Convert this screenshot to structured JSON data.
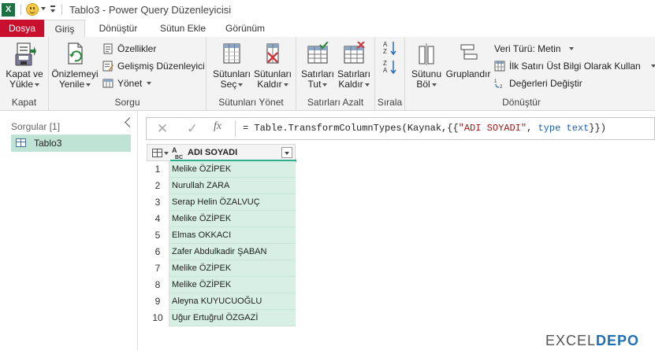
{
  "titlebar": {
    "app_icon": "X",
    "title": "Tablo3 - Power Query Düzenleyicisi"
  },
  "tabs": [
    {
      "label": "Dosya"
    },
    {
      "label": "Giriş"
    },
    {
      "label": "Dönüştür"
    },
    {
      "label": "Sütun Ekle"
    },
    {
      "label": "Görünüm"
    }
  ],
  "ribbon": {
    "kapat": {
      "btn1": "Kapat ve",
      "btn2": "Yükle",
      "group": "Kapat"
    },
    "sorgu": {
      "preview1": "Önizlemeyi",
      "preview2": "Yenile",
      "properties": "Özellikler",
      "advanced": "Gelişmiş Düzenleyici",
      "manage": "Yönet",
      "group": "Sorgu"
    },
    "columns": {
      "choose1": "Sütunları",
      "choose2": "Seç",
      "remove1": "Sütunları",
      "remove2": "Kaldır",
      "group": "Sütunları Yönet"
    },
    "rows": {
      "keep1": "Satırları",
      "keep2": "Tut",
      "remove1": "Satırları",
      "remove2": "Kaldır",
      "group": "Satırları Azalt"
    },
    "sort": {
      "group": "Sırala"
    },
    "transform": {
      "split1": "Sütunu",
      "split2": "Böl",
      "groupby": "Gruplandır",
      "datatype": "Veri Türü: Metin",
      "header": "İlk Satırı Üst Bilgi Olarak Kullan",
      "replace": "Değerleri Değiştir",
      "group": "Dönüştür"
    }
  },
  "queries": {
    "header": "Sorgular [1]",
    "items": [
      {
        "label": "Tablo3"
      }
    ]
  },
  "formula": {
    "fx": "fx",
    "part1": "= Table.TransformColumnTypes(Kaynak,{{",
    "part2": "\"ADI SOYADI\"",
    "part3": ", ",
    "part4": "type text",
    "part5": "}})"
  },
  "table": {
    "column": "ADI SOYADI",
    "type_icon_top": "A",
    "type_icon_bottom": "BC",
    "rows": [
      {
        "n": "1",
        "v": "Melike ÖZİPEK"
      },
      {
        "n": "2",
        "v": "Nurullah ZARA"
      },
      {
        "n": "3",
        "v": "Serap Helin ÖZALVUÇ"
      },
      {
        "n": "4",
        "v": "Melike ÖZİPEK"
      },
      {
        "n": "5",
        "v": "Elmas OKKACI"
      },
      {
        "n": "6",
        "v": "Zafer Abdulkadir ŞABAN"
      },
      {
        "n": "7",
        "v": "Melike ÖZİPEK"
      },
      {
        "n": "8",
        "v": "Melike ÖZİPEK"
      },
      {
        "n": "9",
        "v": "Aleyna KUYUCUOĞLU"
      },
      {
        "n": "10",
        "v": "Uğur Ertuğrul ÖZGAZİ"
      }
    ]
  },
  "watermark": {
    "a": "EXCEL",
    "b": "DEPO"
  },
  "colors": {
    "file_tab": "#c8102e",
    "cell_bg": "#d7efe5",
    "quality_bar": "#2eae8a",
    "selected_query": "#bfe3d4"
  }
}
